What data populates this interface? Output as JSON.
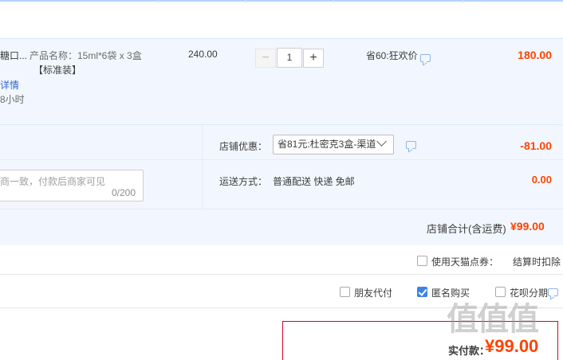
{
  "product": {
    "name_fragment": "糖口...",
    "attr_line1": "产品名称：15ml*6袋 x 3盒",
    "attr_line2": "【标准装】",
    "detail_link": "详情",
    "delivery_fragment": "8小时",
    "unit_price": "240.00",
    "quantity": "1",
    "qty_minus": "−",
    "qty_plus": "+",
    "promo": "省60:狂欢价",
    "subtotal": "180.00"
  },
  "shop": {
    "discount_label": "店铺优惠：",
    "discount_select": "省81元:杜密克3盒-渠道",
    "discount_value": "-81.00",
    "message_placeholder": "商一致，付款后商家可见",
    "message_count": "0/200",
    "shipping_label": "运送方式：",
    "shipping_value": "普通配送 快递 免邮",
    "shipping_fee": "0.00",
    "total_label": "店铺合计(含运费)",
    "total_value": "¥99.00"
  },
  "coupon": {
    "label": "使用天猫点券：",
    "note": "结算时扣除"
  },
  "options": {
    "friend_pay": "朋友代付",
    "anonymous": "匿名购买",
    "huabei": "花呗分期"
  },
  "payment": {
    "label": "实付款：",
    "value": "¥99.00"
  },
  "watermark": "值值值",
  "icons": {
    "chat": "chat-bubble-icon",
    "check": "checkmark-icon",
    "chevron": "chevron-down-icon"
  },
  "colors": {
    "price_red": "#ff4400",
    "link_blue": "#3366cc",
    "row_bg": "#f2f7ff",
    "checked_blue": "#3e82e8",
    "pay_border": "#d8002e"
  }
}
